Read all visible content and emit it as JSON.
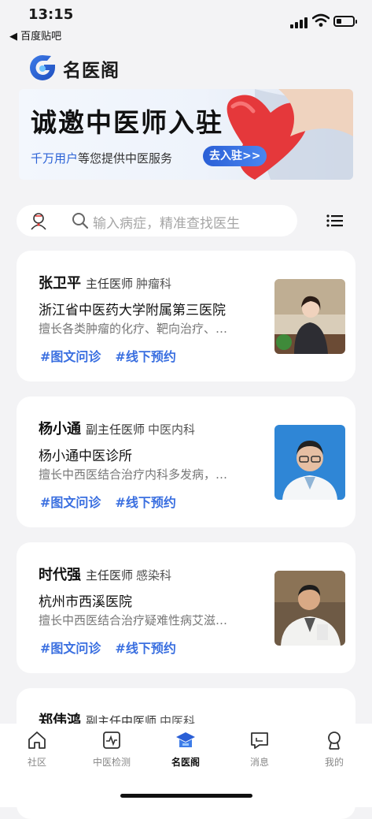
{
  "status": {
    "time": "13:15",
    "back_label": "◀ 百度贴吧"
  },
  "header": {
    "brand": "名医阁"
  },
  "banner": {
    "title": "诚邀中医师入驻",
    "sub_highlight": "千万用户",
    "sub_rest": "等您提供中医服务",
    "button": "去入驻>>"
  },
  "search": {
    "placeholder": "输入病症，精准查找医生"
  },
  "doctors": [
    {
      "name": "张卫平",
      "title": "主任医师",
      "dept": "肿瘤科",
      "hospital": "浙江省中医药大学附属第三医院",
      "skill": "擅长各类肿瘤的化疗、靶向治疗、…",
      "tag1": "#图文问诊",
      "tag2": "#线下预约"
    },
    {
      "name": "杨小通",
      "title": "副主任医师",
      "dept": "中医内科",
      "hospital": "杨小通中医诊所",
      "skill": "擅长中西医结合治疗内科多发病，…",
      "tag1": "#图文问诊",
      "tag2": "#线下预约"
    },
    {
      "name": "时代强",
      "title": "主任医师",
      "dept": "感染科",
      "hospital": "杭州市西溪医院",
      "skill": "擅长中西医结合治疗疑难性病艾滋…",
      "tag1": "#图文问诊",
      "tag2": "#线下预约"
    },
    {
      "name": "郑伟鸿",
      "title": "副主任中医师",
      "dept": "中医科"
    }
  ],
  "nav": [
    {
      "label": "社区",
      "icon": "home-icon"
    },
    {
      "label": "中医检测",
      "icon": "pulse-icon"
    },
    {
      "label": "名医阁",
      "icon": "doctor-hat-icon",
      "active": true
    },
    {
      "label": "消息",
      "icon": "message-icon"
    },
    {
      "label": "我的",
      "icon": "profile-icon"
    }
  ],
  "colors": {
    "accent": "#3a6fe0",
    "background": "#f3f3f5"
  }
}
